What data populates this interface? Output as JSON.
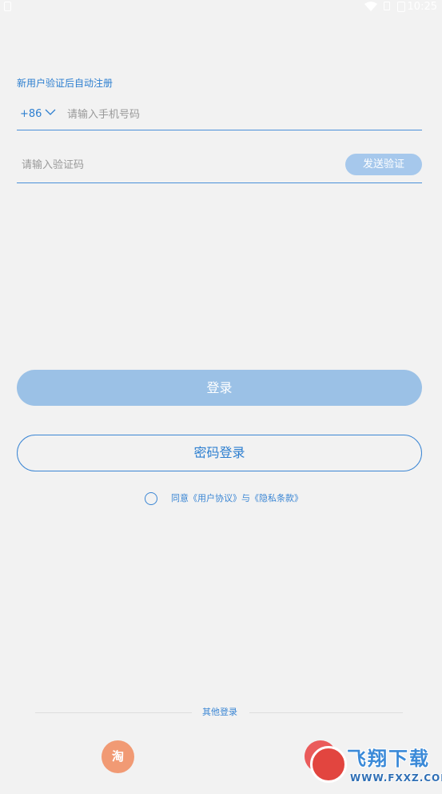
{
  "status_bar": {
    "time": "10:25"
  },
  "form": {
    "hint": "新用户验证后自动注册",
    "country_code": "+86",
    "phone_placeholder": "请输入手机号码",
    "code_placeholder": "请输入验证码",
    "send_code_label": "发送验证"
  },
  "buttons": {
    "login_label": "登录",
    "password_login_label": "密码登录"
  },
  "agreement": {
    "prefix": "同意",
    "user_agreement": "《用户协议》",
    "conjunction": "与",
    "privacy": "《隐私条款》"
  },
  "other_login": {
    "label": "其他登录",
    "taobao_glyph": "淘"
  },
  "watermark": {
    "title": "飞翔下载",
    "url": "WWW.FXXZ.COM"
  },
  "colors": {
    "accent": "#2d7fd0",
    "button_disabled": "#9bc1e6",
    "background": "#f2f2f2"
  }
}
